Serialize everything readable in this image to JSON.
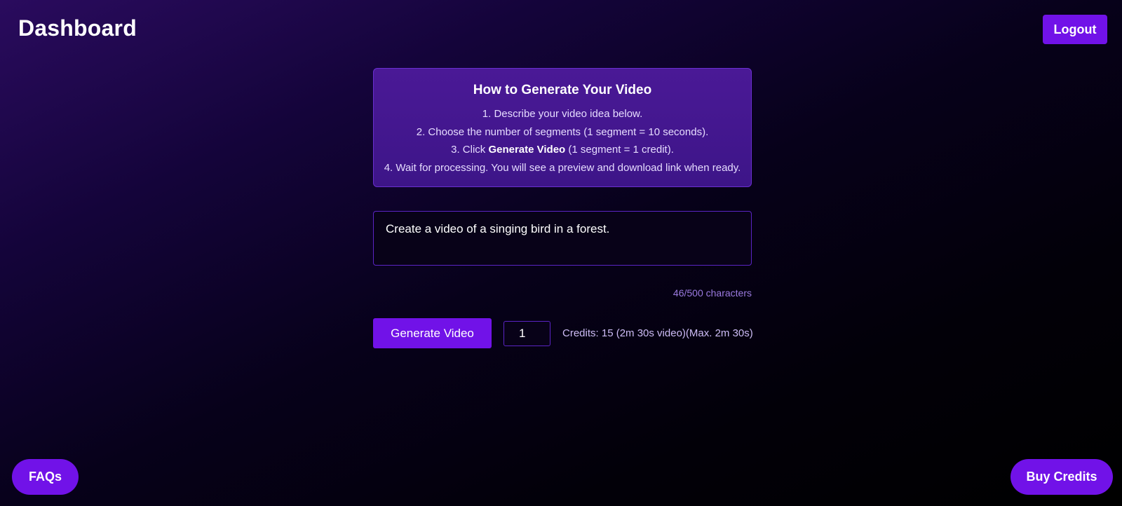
{
  "header": {
    "title": "Dashboard",
    "logout_label": "Logout"
  },
  "instructions": {
    "heading": "How to Generate Your Video",
    "step1": "1. Describe your video idea below.",
    "step2": "2. Choose the number of segments (1 segment = 10 seconds).",
    "step3_prefix": "3. Click ",
    "step3_bold": "Generate Video",
    "step3_suffix": " (1 segment = 1 credit).",
    "step4": "4. Wait for processing. You will see a preview and download link when ready."
  },
  "prompt": {
    "value": "Create a video of a singing bird in a forest.",
    "char_count": "46/500 characters"
  },
  "controls": {
    "generate_label": "Generate Video",
    "segments_value": "1",
    "credits_text": "Credits: 15 (2m 30s video)(Max. 2m 30s)"
  },
  "footer": {
    "faq_label": "FAQs",
    "buy_credits_label": "Buy Credits"
  },
  "colors": {
    "accent": "#7112e8",
    "panel": "#4a1996",
    "muted_text": "#9b7ae0"
  }
}
